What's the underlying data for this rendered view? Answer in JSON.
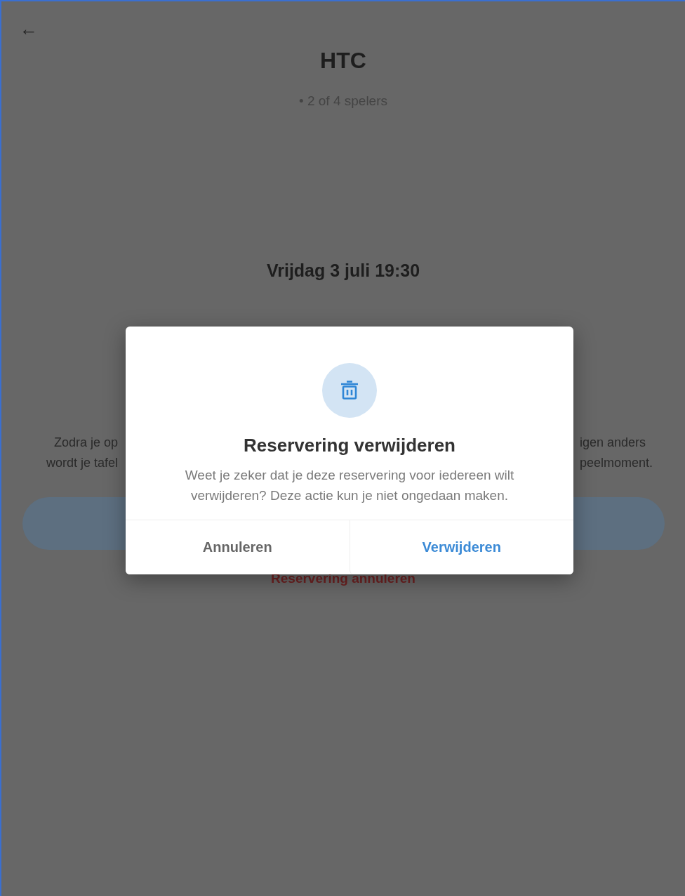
{
  "header": {
    "back": "←",
    "title": "HTC",
    "players": "• 2 of 4 spelers"
  },
  "reservation": {
    "date": "Vrijdag 3 juli 19:30",
    "info_left": [
      "Zodra je op",
      "wordt je tafel"
    ],
    "info_right": [
      "igen anders",
      "peelmoment."
    ],
    "cancel_link": "Reservering annuleren"
  },
  "dialog": {
    "title": "Reservering verwijderen",
    "message": "Weet je zeker dat je deze reservering voor iedereen wilt verwijderen? Deze actie kun je niet ongedaan maken.",
    "buttons": [
      {
        "label": "Annuleren",
        "kind": "secondary"
      },
      {
        "label": "Verwijderen",
        "kind": "primary"
      }
    ]
  }
}
